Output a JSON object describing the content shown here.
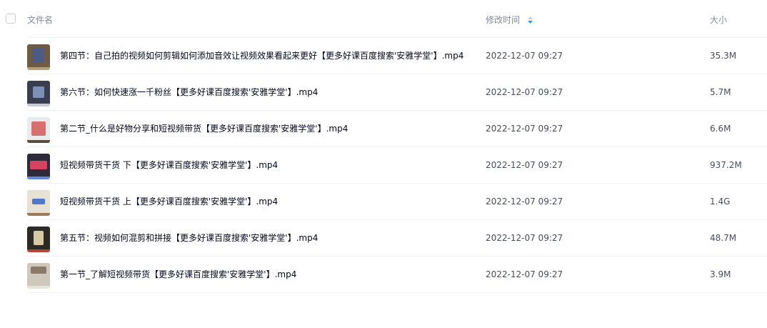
{
  "header": {
    "name_label": "文件名",
    "mtime_label": "修改时间",
    "size_label": "大小"
  },
  "colors": {
    "sort_active": "#06a7ff",
    "sort_inactive": "#c9ced6",
    "text_primary": "#03081a",
    "text_secondary": "#454d5a",
    "header_text": "#818999",
    "divider": "#f1f2f4"
  },
  "files": [
    {
      "name": "第四节：自己拍的视频如何剪辑如何添加音效让视频效果看起来更好【更多好课百度搜索'安雅学堂'】.mp4",
      "modified": "2022-12-07 09:27",
      "size": "35.3M",
      "icon": "video-thumbnail-icon",
      "thumb_colors": [
        "#6e5b45",
        "#4b5b86",
        "#b99f78"
      ]
    },
    {
      "name": "第六节：如何快速涨一千粉丝【更多好课百度搜索'安雅学堂'】.mp4",
      "modified": "2022-12-07 09:27",
      "size": "5.7M",
      "icon": "video-thumbnail-icon",
      "thumb_colors": [
        "#3a3f4f",
        "#7c8fb6",
        "#c9c9d2"
      ]
    },
    {
      "name": "第二节_什么是好物分享和短视频带货【更多好课百度搜索'安雅学堂'】.mp4",
      "modified": "2022-12-07 09:27",
      "size": "6.6M",
      "icon": "video-thumbnail-icon",
      "thumb_colors": [
        "#e9eaee",
        "#d76f6f",
        "#5d4a3d"
      ]
    },
    {
      "name": "短视频带货干货 下【更多好课百度搜索'安雅学堂'】.mp4",
      "modified": "2022-12-07 09:27",
      "size": "937.2M",
      "icon": "video-thumbnail-icon",
      "thumb_colors": [
        "#2f2a3a",
        "#d7435e",
        "#5f89d8"
      ]
    },
    {
      "name": "短视频带货干货 上【更多好课百度搜索'安雅学堂'】.mp4",
      "modified": "2022-12-07 09:27",
      "size": "1.4G",
      "icon": "video-thumbnail-icon",
      "thumb_colors": [
        "#e7e1d6",
        "#4f79c8",
        "#9a7a57"
      ]
    },
    {
      "name": "第五节：视频如何混剪和拼接【更多好课百度搜索'安雅学堂'】.mp4",
      "modified": "2022-12-07 09:27",
      "size": "48.7M",
      "icon": "video-thumbnail-icon",
      "thumb_colors": [
        "#2c2a24",
        "#d8c9a5",
        "#b64538"
      ]
    },
    {
      "name": "第一节_了解短视频带货【更多好课百度搜索'安雅学堂'】.mp4",
      "modified": "2022-12-07 09:27",
      "size": "3.9M",
      "icon": "video-thumbnail-icon",
      "thumb_colors": [
        "#cfc8bd",
        "#8b7867",
        "#e7e2da"
      ]
    }
  ]
}
